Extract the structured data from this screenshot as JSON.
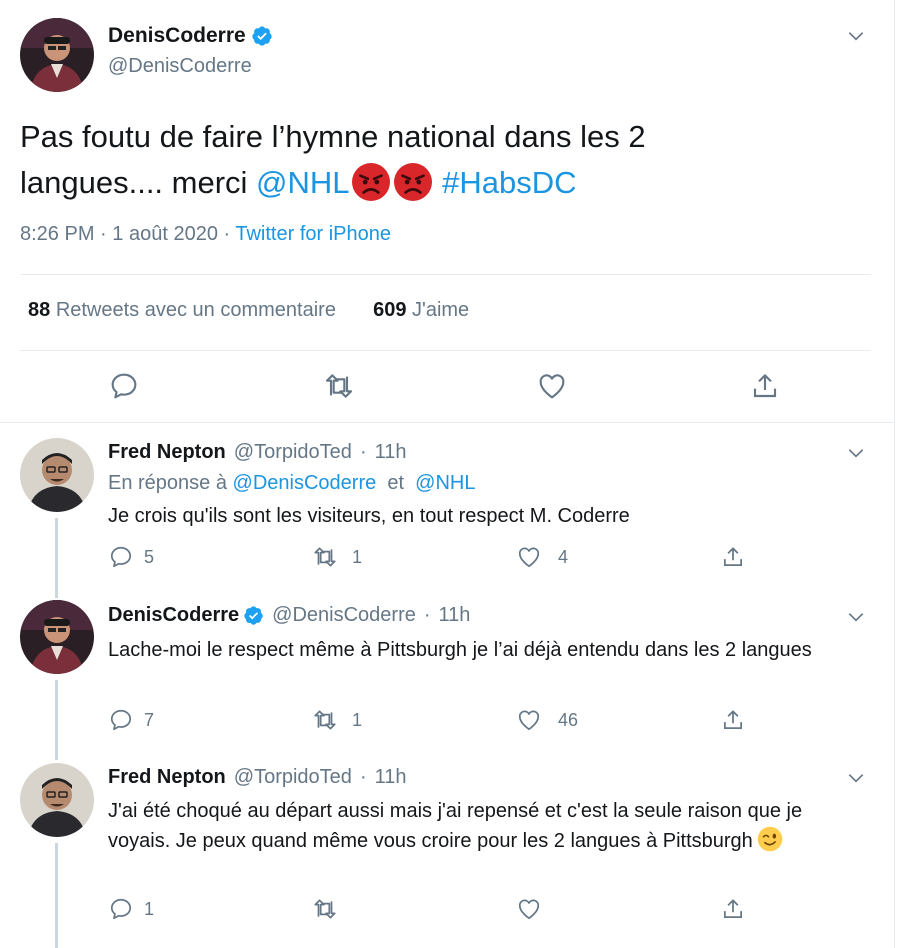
{
  "main_tweet": {
    "author_name": "DenisCoderre",
    "author_handle": "@DenisCoderre",
    "text_line1": "Pas foutu de faire l’hymne national dans les 2",
    "text_line2_prefix": "langues.... merci ",
    "mention": "@NHL",
    "hashtag": "#HabsDC",
    "time": "8:26 PM",
    "separator": "·",
    "date": "1 août 2020",
    "source": "Twitter for iPhone",
    "retweets_count": "88",
    "retweets_label": "Retweets avec un commentaire",
    "likes_count": "609",
    "likes_label": "J'aime"
  },
  "replies": [
    {
      "author_name": "Fred Nepton",
      "author_handle": "@TorpidoTed",
      "separator": "·",
      "time": "11h",
      "reply_to_prefix": "En réponse à ",
      "reply_to_user1": "@DenisCoderre",
      "reply_to_and": "  et  ",
      "reply_to_user2": "@NHL",
      "text": "Je crois qu'ils sont les visiteurs, en tout respect M. Coderre",
      "replies": "5",
      "retweets": "1",
      "likes": "4"
    },
    {
      "author_name": "DenisCoderre",
      "author_handle": "@DenisCoderre",
      "separator": "·",
      "time": "11h",
      "text": "Lache-moi le respect même à Pittsburgh je l’ai déjà entendu dans les 2 langues",
      "replies": "7",
      "retweets": "1",
      "likes": "46"
    },
    {
      "author_name": "Fred Nepton",
      "author_handle": "@TorpidoTed",
      "separator": "·",
      "time": "11h",
      "text": "J'ai été choqué au départ aussi mais j'ai repensé et c'est la seule raison que je voyais.  Je peux quand même vous croire pour les 2 langues à Pittsburgh",
      "replies": "1",
      "retweets": "",
      "likes": ""
    }
  ],
  "colors": {
    "accent": "#1b95e0",
    "text": "#14171a",
    "muted": "#657786",
    "divider": "#e6ecf0",
    "angry_emoji": "#d9262b"
  },
  "icons": [
    "verified-badge-icon",
    "chevron-down-icon",
    "reply-icon",
    "retweet-icon",
    "like-icon",
    "share-icon",
    "angry-face-emoji",
    "winking-face-emoji"
  ]
}
